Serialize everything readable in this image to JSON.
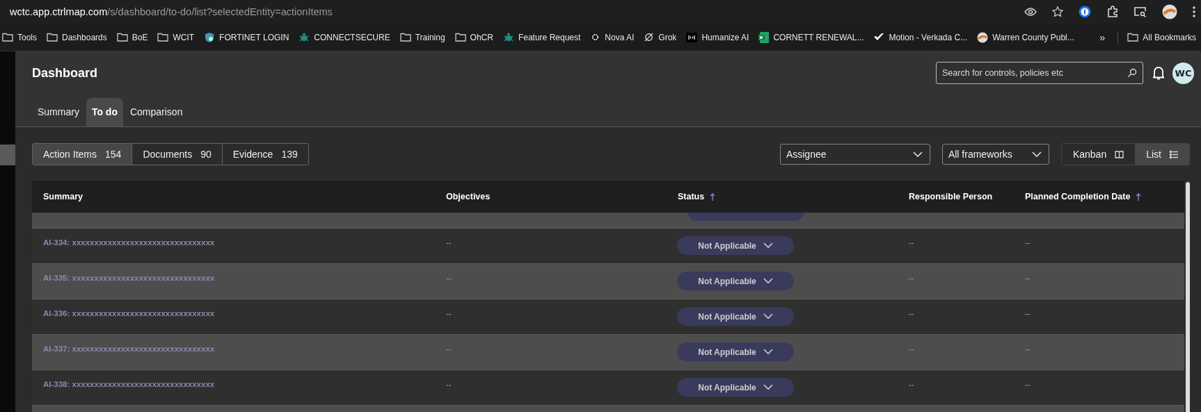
{
  "browser": {
    "url_domain": "wctc.app.ctrlmap.com",
    "url_path": "/s/dashboard/to-do/list?selectedEntity=actionItems",
    "bookmarks": [
      {
        "label": "Tools",
        "kind": "folder"
      },
      {
        "label": "Dashboards",
        "kind": "folder"
      },
      {
        "label": "BoE",
        "kind": "folder"
      },
      {
        "label": "WCIT",
        "kind": "folder"
      },
      {
        "label": "FORTINET LOGIN",
        "kind": "shield"
      },
      {
        "label": "CONNECTSECURE",
        "kind": "turtle"
      },
      {
        "label": "Training",
        "kind": "folder"
      },
      {
        "label": "OhCR",
        "kind": "folder"
      },
      {
        "label": "Feature Request",
        "kind": "turtle"
      },
      {
        "label": "Nova AI",
        "kind": "gear"
      },
      {
        "label": "Grok",
        "kind": "slash"
      },
      {
        "label": "Humanize AI",
        "kind": "badge"
      },
      {
        "label": "CORNETT RENEWAL...",
        "kind": "sheet"
      },
      {
        "label": "Motion - Verkada C...",
        "kind": "check"
      },
      {
        "label": "Warren County Publ...",
        "kind": "round"
      }
    ],
    "more": "»",
    "all_bookmarks": "All Bookmarks"
  },
  "page": {
    "title": "Dashboard",
    "search": {
      "placeholder": "Search for controls, policies etc"
    },
    "avatar": "WC",
    "tabs": [
      {
        "label": "Summary",
        "selected": false
      },
      {
        "label": "To do",
        "selected": true
      },
      {
        "label": "Comparison",
        "selected": false
      }
    ],
    "segments": [
      {
        "label": "Action Items",
        "count": "154",
        "selected": true
      },
      {
        "label": "Documents",
        "count": "90",
        "selected": false
      },
      {
        "label": "Evidence",
        "count": "139",
        "selected": false
      }
    ],
    "filters": [
      "Assignee",
      "All frameworks"
    ],
    "views": [
      {
        "label": "Kanban",
        "kind": "kanban",
        "selected": false
      },
      {
        "label": "List",
        "kind": "list",
        "selected": true
      }
    ]
  },
  "table": {
    "columns": [
      {
        "label": "Summary",
        "sorted": false
      },
      {
        "label": "Objectives",
        "sorted": false
      },
      {
        "label": "Status",
        "sorted": true
      },
      {
        "label": "Responsible Person",
        "sorted": false
      },
      {
        "label": "Planned Completion Date",
        "sorted": true
      }
    ],
    "rows": [
      {
        "summary": "AI-334: xxxxxxxxxxxxxxxxxxxxxxxxxxxxxxxx",
        "objectives": "--",
        "status": "Not Applicable",
        "responsible": "--",
        "planned": "--"
      },
      {
        "summary": "AI-335: xxxxxxxxxxxxxxxxxxxxxxxxxxxxxxxx",
        "objectives": "--",
        "status": "Not Applicable",
        "responsible": "--",
        "planned": "--"
      },
      {
        "summary": "AI-336: xxxxxxxxxxxxxxxxxxxxxxxxxxxxxxxx",
        "objectives": "--",
        "status": "Not Applicable",
        "responsible": "--",
        "planned": "--"
      },
      {
        "summary": "AI-337: xxxxxxxxxxxxxxxxxxxxxxxxxxxxxxxx",
        "objectives": "--",
        "status": "Not Applicable",
        "responsible": "--",
        "planned": "--"
      },
      {
        "summary": "AI-338: xxxxxxxxxxxxxxxxxxxxxxxxxxxxxxxx",
        "objectives": "--",
        "status": "Not Applicable",
        "responsible": "--",
        "planned": "--"
      }
    ]
  }
}
